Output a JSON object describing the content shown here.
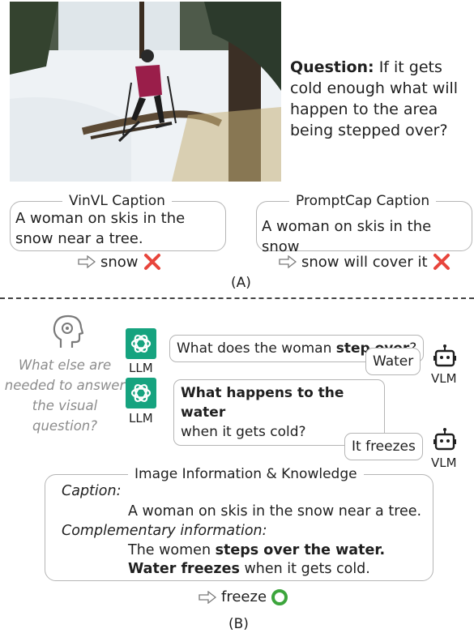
{
  "question": {
    "prefix": "Question:",
    "text": " If it gets cold enough what will happen to the area being stepped over?"
  },
  "vinvl": {
    "title": "VinVL Caption",
    "caption": "A woman on skis in the snow near a tree.",
    "answer": "snow"
  },
  "promptcap": {
    "title": "PromptCap Caption",
    "caption": "A woman on skis in the snow",
    "answer": "snow will cover it"
  },
  "label_a": "(A)",
  "thought": "What else are needed to answer the visual question?",
  "dialog": {
    "q1_pre": "What does the woman ",
    "q1_bold": "step over",
    "q1_post": "?",
    "a1": "Water",
    "q2_bold": "What happens to the water",
    "q2_post": "when it gets cold?",
    "a2": "It freezes",
    "llm": "LLM",
    "vlm": "VLM"
  },
  "info": {
    "title": "Image Information & Knowledge",
    "caption_label": "Caption:",
    "caption": "A woman on skis in the snow near a tree.",
    "comp_label": "Complementary information:",
    "line1_pre": "The women ",
    "line1_bold": "steps over the water.",
    "line2_bold": "Water freezes",
    "line2_post": " when it gets cold."
  },
  "final_answer": "freeze",
  "label_b": "(B)",
  "colors": {
    "gpt": "#16a37f",
    "cross": "#e8453c",
    "ring": "#3ca53c",
    "thought": "#8c8c8c"
  },
  "icons": [
    "head-gear-icon",
    "chatgpt-icon",
    "robot-icon",
    "arrow-icon",
    "cross-icon",
    "ring-icon"
  ]
}
